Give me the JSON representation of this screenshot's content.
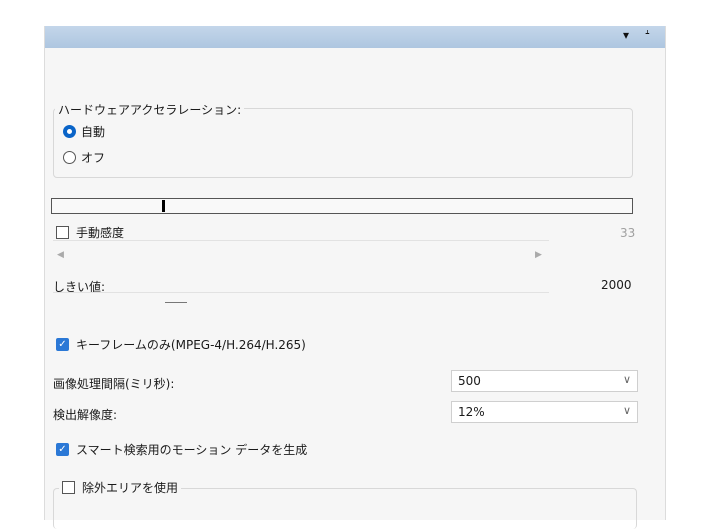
{
  "titlebar": {
    "dropdown_icon": "▾",
    "pin_icon": "ᗮ"
  },
  "hw_accel": {
    "legend": "ハードウェアアクセラレーション:",
    "options": [
      {
        "label": "自動",
        "selected": true
      },
      {
        "label": "オフ",
        "selected": false
      }
    ]
  },
  "sensitivity": {
    "meter_value": 0.19,
    "manual_label": "手動感度",
    "manual_checked": false,
    "value": "33",
    "left_arrow": "◀",
    "right_arrow": "▶"
  },
  "threshold": {
    "label": "しきい値:",
    "value": "2000"
  },
  "keyframe": {
    "label": "キーフレームのみ(MPEG-4/H.264/H.265)",
    "checked": true
  },
  "interval": {
    "label": "画像処理間隔(ミリ秒):",
    "value": "500"
  },
  "resolution": {
    "label": "検出解像度:",
    "value": "12%"
  },
  "smart_search": {
    "label": "スマート検索用のモーション データを生成",
    "checked": true
  },
  "exclude": {
    "label": "除外エリアを使用",
    "checked": false
  },
  "chevron": "∨",
  "checkmark": "✓",
  "colors": {
    "accent": "#2b78d6",
    "titlebar": "#b6cce4"
  }
}
